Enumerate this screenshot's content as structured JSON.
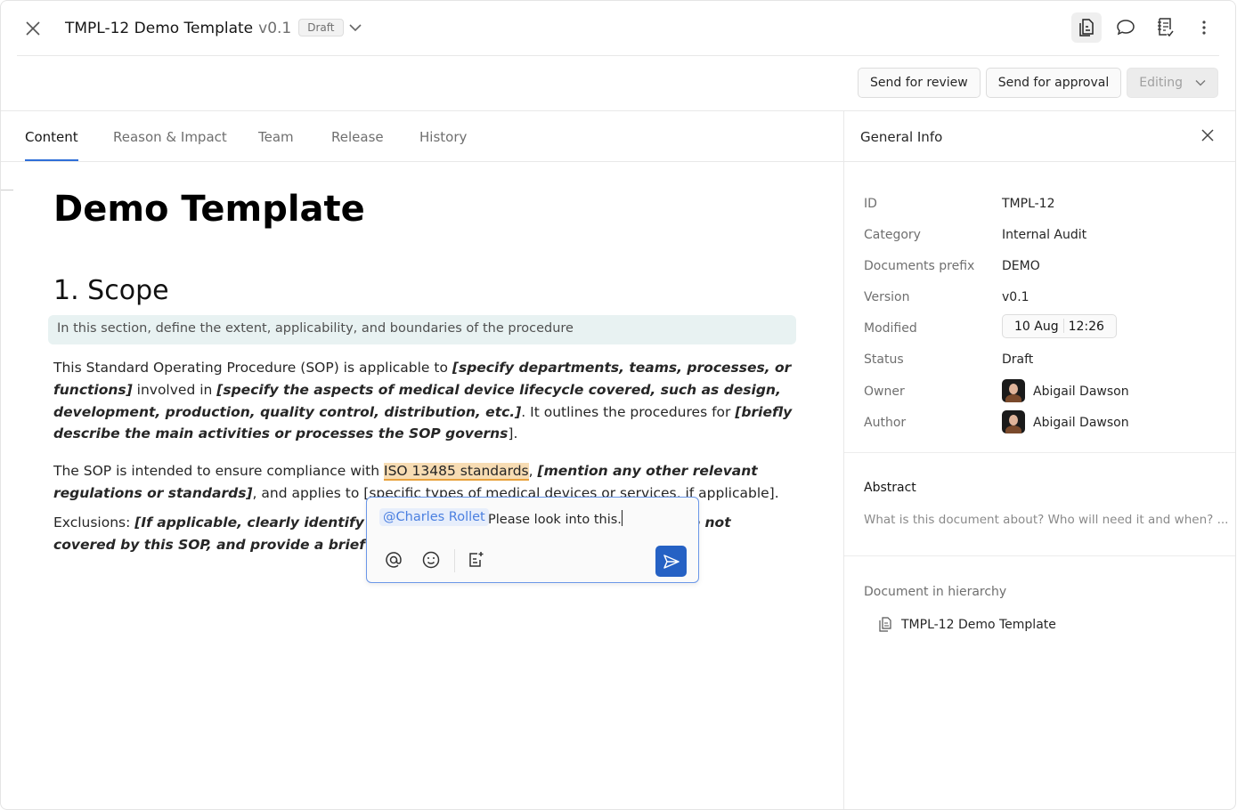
{
  "header": {
    "title": "TMPL-12 Demo Template",
    "version": "v0.1",
    "status_badge": "Draft",
    "icons": [
      "document-panel-icon",
      "comment-icon",
      "checklist-icon",
      "more-vertical-icon"
    ]
  },
  "actions": {
    "send_review": "Send for review",
    "send_approval": "Send for approval",
    "mode": "Editing"
  },
  "tabs": [
    {
      "label": "Content",
      "active": true
    },
    {
      "label": "Reason & Impact"
    },
    {
      "label": "Team"
    },
    {
      "label": "Release"
    },
    {
      "label": "History"
    }
  ],
  "document": {
    "title": "Demo Template",
    "section_number": "1.",
    "section_title": "Scope",
    "hint": "In this section, define the extent, applicability, and boundaries of the procedure",
    "paragraphs": [
      [
        {
          "t": "This Standard Operating Procedure (SOP) is applicable to "
        },
        {
          "t": "[specify departments, teams, processes, or functions]",
          "b": true
        },
        {
          "t": " involved in "
        },
        {
          "t": "[specify the aspects of medical device lifecycle covered, such as design, development, production, quality control, distribution, etc.]",
          "b": true
        },
        {
          "t": ". It outlines the procedures for "
        },
        {
          "t": "[briefly describe the main activities or processes the SOP governs",
          "b": true
        },
        {
          "t": "]."
        }
      ],
      [
        {
          "t": "The SOP is intended to ensure compliance with "
        },
        {
          "t": "ISO 13485 standards",
          "hl": true
        },
        {
          "t": ", "
        },
        {
          "t": "[mention any other relevant regulations or standards]",
          "b": true
        },
        {
          "t": ", and applies to [specific types of medical devices or services, if applicable]."
        }
      ],
      [
        {
          "t": "Exclusions: "
        },
        {
          "t": "[If applicable, clearly identify any processes, products, or areas that are not covered by this SOP, and provide a brief justification for exclusion]",
          "b": true
        }
      ]
    ]
  },
  "comment": {
    "mention": "@Charles Rollet",
    "text": "Please look into this.",
    "accent": "#2561c4"
  },
  "panel": {
    "title": "General Info",
    "fields": [
      {
        "label": "ID",
        "value": "TMPL-12"
      },
      {
        "label": "Category",
        "value": "Internal Audit"
      },
      {
        "label": "Documents prefix",
        "value": "DEMO"
      },
      {
        "label": "Version",
        "value": "v0.1"
      },
      {
        "label": "Modified",
        "date": "10 Aug",
        "time": "12:26"
      },
      {
        "label": "Status",
        "value": "Draft"
      },
      {
        "label": "Owner",
        "value": "Abigail Dawson"
      },
      {
        "label": "Author",
        "value": "Abigail Dawson"
      }
    ],
    "abstract_label": "Abstract",
    "abstract_placeholder": "What is this document about? Who will need it and when? ...",
    "hierarchy_label": "Document in hierarchy",
    "hierarchy_item": "TMPL-12 Demo Template"
  }
}
